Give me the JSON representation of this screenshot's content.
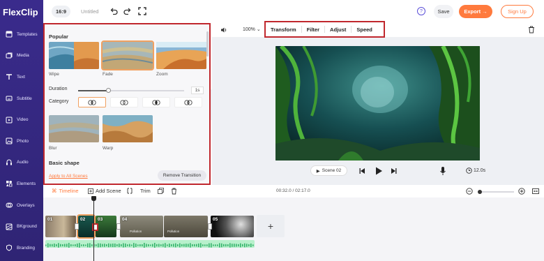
{
  "app": {
    "logo": "FlexClip",
    "aspect_ratio": "16:9",
    "project_title": "Untitled"
  },
  "header": {
    "save_label": "Save",
    "export_label": "Export →",
    "signup_label": "Sign Up",
    "help_label": "?"
  },
  "sidebar": {
    "items": [
      {
        "label": "Templates",
        "icon": "templates-icon"
      },
      {
        "label": "Media",
        "icon": "media-icon"
      },
      {
        "label": "Text",
        "icon": "text-icon"
      },
      {
        "label": "Subtitle",
        "icon": "subtitle-icon"
      },
      {
        "label": "Video",
        "icon": "video-icon"
      },
      {
        "label": "Photo",
        "icon": "photo-icon"
      },
      {
        "label": "Audio",
        "icon": "audio-icon"
      },
      {
        "label": "Elements",
        "icon": "elements-icon"
      },
      {
        "label": "Overlays",
        "icon": "overlays-icon"
      },
      {
        "label": "BKground",
        "icon": "background-icon"
      },
      {
        "label": "Branding",
        "icon": "branding-icon"
      }
    ]
  },
  "panel": {
    "popular_title": "Popular",
    "transitions": [
      {
        "label": "Wipe"
      },
      {
        "label": "Fade",
        "selected": true
      },
      {
        "label": "Zoom"
      }
    ],
    "duration_label": "Duration",
    "duration_value": "1s",
    "duration_fraction": 0.28,
    "category_label": "Category",
    "category_transitions": [
      {
        "label": "Blur"
      },
      {
        "label": "Warp"
      }
    ],
    "basic_shape_title": "Basic shape",
    "apply_all_label": "Apply to All Scenes",
    "remove_label": "Remove Transition"
  },
  "editor": {
    "zoom_value": "100%",
    "tabs": [
      "Transform",
      "Filter",
      "Adjust",
      "Speed"
    ],
    "scene_label": "Scene 02",
    "duration_text": "12.0s"
  },
  "timeline": {
    "timeline_label": "Timeline",
    "add_scene_label": "Add Scene",
    "trim_label": "Trim",
    "time_display": "00:32.0 / 02:17.0",
    "zoom_fraction": 0.0,
    "clips": [
      {
        "num": "01"
      },
      {
        "num": "02",
        "selected": true
      },
      {
        "num": "03"
      },
      {
        "num": "04",
        "caption": "Pollution"
      },
      {
        "num": "",
        "caption": "Pollution"
      },
      {
        "num": "05"
      }
    ],
    "add_label": "+"
  },
  "colors": {
    "sidebar": "#3a2b8c",
    "accent": "#ff7a3d",
    "highlight_box": "#c0272d",
    "selection": "#f0a060",
    "audio": "#b8f0cc"
  }
}
